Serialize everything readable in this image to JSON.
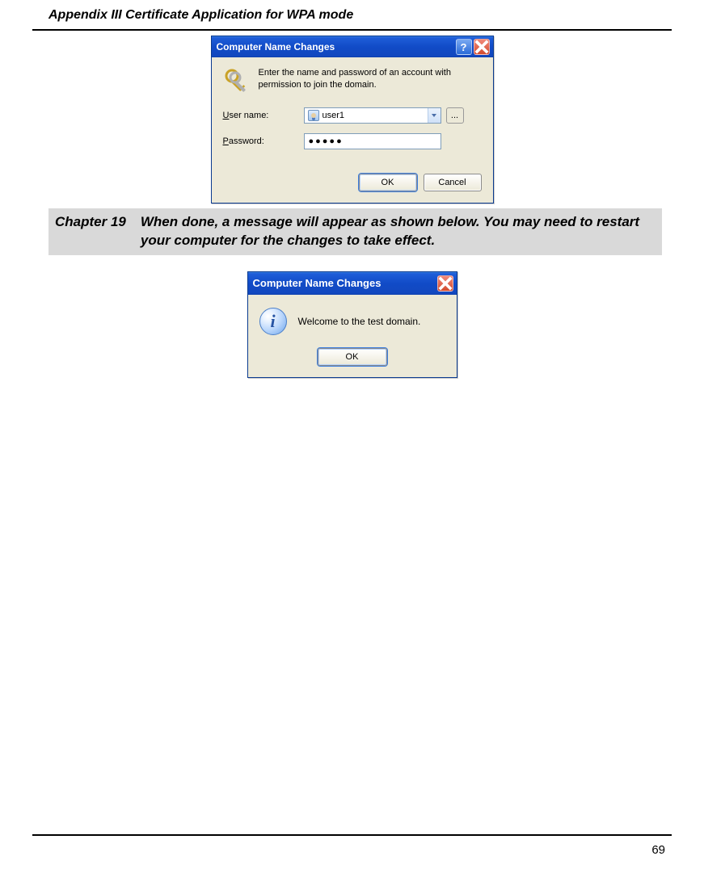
{
  "header": {
    "title": "Appendix III  Certificate Application for WPA mode"
  },
  "dialog1": {
    "title": "Computer Name Changes",
    "instruction": "Enter the name and password of an account with permission to join the domain.",
    "labels": {
      "user_prefix": "U",
      "user_rest": "ser name:",
      "pass_prefix": "P",
      "pass_rest": "assword:"
    },
    "user_value": "user1",
    "browse_label": "...",
    "password_masked": "●●●●●",
    "ok_label": "OK",
    "cancel_label": "Cancel"
  },
  "chapter": {
    "label": "Chapter 19",
    "text": "When done, a message will appear as shown below. You may need to restart your computer for the changes to take effect."
  },
  "dialog2": {
    "title": "Computer Name Changes",
    "message": "Welcome to the test domain.",
    "ok_label": "OK"
  },
  "page_number": "69"
}
